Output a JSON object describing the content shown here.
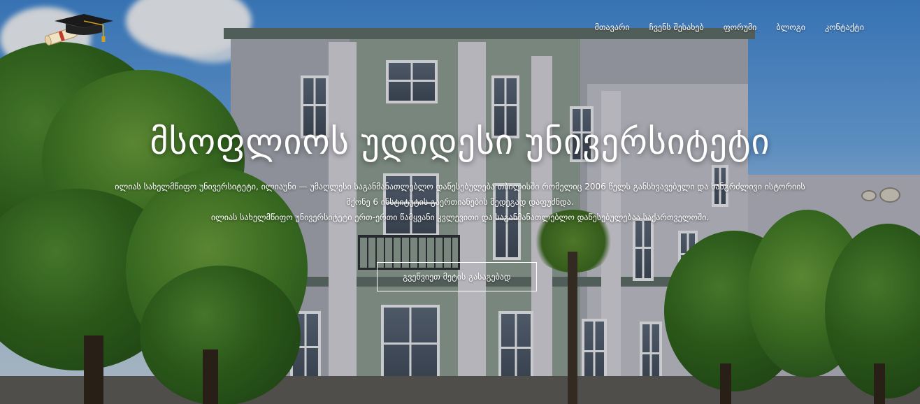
{
  "nav": {
    "items": [
      {
        "label": "მთავარი"
      },
      {
        "label": "ჩვენს შესახებ"
      },
      {
        "label": "ფორუმი"
      },
      {
        "label": "ბლოგი"
      },
      {
        "label": "კონტაქტი"
      }
    ]
  },
  "logo": {
    "icon": "graduation-cap-diploma-icon"
  },
  "hero": {
    "title": "მსოფლიოს უდიდესი უნივერსიტეტი",
    "description_line1": "ილიას სახელმწიფო უნივერსიტეტი, ილიაუნი — უმაღლესი საგანმანათლებლო დაწესებულება თბილისში რომელიც 2006 წელს განსხვავებული და ხანგრძლივი ისტორიის",
    "description_line2": "მქონე 6 ინსტიტუტის გაერთიანების შედეგად დაფუძნდა.",
    "description_line3": "ილიას სახელმწიფო უნივერსიტეტი ერთ-ერთი წამყვანი კვლევითი და საგანმანათლებლო დაწესებულებაა საქართველოში.",
    "cta_label": "გვეწვიეთ მეტის გასაგებად"
  },
  "colors": {
    "text": "#ffffff",
    "sky": "#3f86d4",
    "foliage": "#2f6518"
  }
}
